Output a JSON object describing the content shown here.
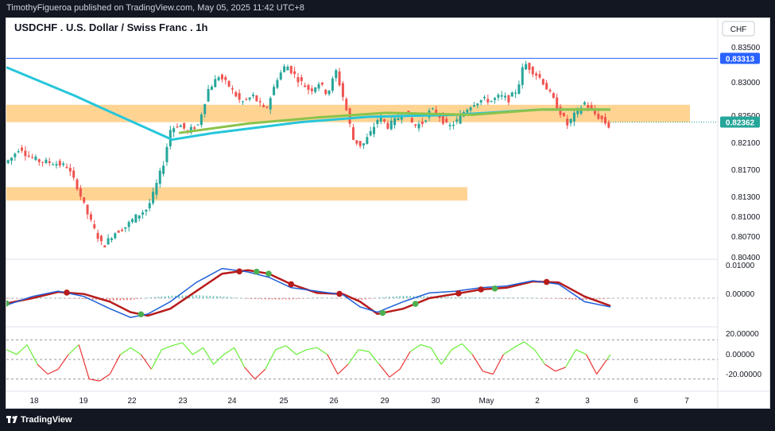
{
  "header": {
    "published_text": "TimothyFigueroa published on TradingView.com, May 05, 2025 11:42 UTC+8"
  },
  "chart": {
    "title": "USDCHF . U.S. Dollar / Swiss Franc . 1h",
    "currency_label": "CHF",
    "price_labels": [
      "0.83500",
      "0.83000",
      "0.82500",
      "0.82100",
      "0.81700",
      "0.81300",
      "0.81000",
      "0.80700",
      "0.80400"
    ],
    "resistance_badge": "0.83313",
    "last_price_badge": "0.82362",
    "macd_labels": [
      "0.01000",
      "0.00000"
    ],
    "osc_labels": [
      "20.00000",
      "0.00000",
      "-20.00000"
    ],
    "x_labels": [
      "18",
      "19",
      "22",
      "23",
      "24",
      "25",
      "26",
      "29",
      "30",
      "May",
      "2",
      "3",
      "6",
      "7"
    ]
  },
  "footer": {
    "brand": "TradingView"
  },
  "colors": {
    "up": "#26a69a",
    "down": "#ef5350",
    "ma_fast": "#26c6da",
    "ma_slow": "#8bc34a",
    "zone": "#ffcc80",
    "macd": "#1e5fd8",
    "signal": "#b71c1c",
    "osc_up": "#66ee33",
    "osc_down": "#ee3333"
  },
  "chart_data": {
    "type": "candlestick",
    "symbol": "USDCHF",
    "interval": "1h",
    "ylim": [
      0.8035,
      0.8365
    ],
    "x_ticks": [
      "18",
      "19",
      "22",
      "23",
      "24",
      "25",
      "26",
      "29",
      "30",
      "May",
      "2",
      "3",
      "6",
      "7"
    ],
    "horizontal_line": 0.83313,
    "last_price": 0.82362,
    "zones": [
      {
        "low": 0.8236,
        "high": 0.8262
      },
      {
        "low": 0.8119,
        "high": 0.8139
      }
    ],
    "price_path": [
      [
        0,
        0.8175
      ],
      [
        4,
        0.8183
      ],
      [
        9,
        0.82
      ],
      [
        13,
        0.8186
      ],
      [
        20,
        0.8178
      ],
      [
        29,
        0.8175
      ],
      [
        36,
        0.817
      ],
      [
        42,
        0.814
      ],
      [
        47,
        0.8105
      ],
      [
        52,
        0.8075
      ],
      [
        57,
        0.805
      ],
      [
        63,
        0.807
      ],
      [
        70,
        0.808
      ],
      [
        76,
        0.8095
      ],
      [
        82,
        0.8106
      ],
      [
        85,
        0.812
      ],
      [
        92,
        0.8175
      ],
      [
        96,
        0.8225
      ],
      [
        101,
        0.8233
      ],
      [
        106,
        0.8222
      ],
      [
        112,
        0.8232
      ],
      [
        118,
        0.8285
      ],
      [
        124,
        0.8305
      ],
      [
        130,
        0.829
      ],
      [
        137,
        0.8265
      ],
      [
        144,
        0.8275
      ],
      [
        151,
        0.8252
      ],
      [
        158,
        0.8302
      ],
      [
        163,
        0.8322
      ],
      [
        170,
        0.83
      ],
      [
        177,
        0.8283
      ],
      [
        182,
        0.8295
      ],
      [
        187,
        0.8278
      ],
      [
        192,
        0.8312
      ],
      [
        197,
        0.8265
      ],
      [
        202,
        0.821
      ],
      [
        207,
        0.82
      ],
      [
        212,
        0.822
      ],
      [
        217,
        0.8245
      ],
      [
        222,
        0.823
      ],
      [
        227,
        0.824
      ],
      [
        232,
        0.8255
      ],
      [
        237,
        0.823
      ],
      [
        242,
        0.8235
      ],
      [
        247,
        0.8255
      ],
      [
        252,
        0.8245
      ],
      [
        257,
        0.8228
      ],
      [
        262,
        0.8238
      ],
      [
        267,
        0.8255
      ],
      [
        272,
        0.8265
      ],
      [
        277,
        0.827
      ],
      [
        282,
        0.8268
      ],
      [
        287,
        0.8275
      ],
      [
        292,
        0.827
      ],
      [
        297,
        0.8285
      ],
      [
        301,
        0.8325
      ],
      [
        306,
        0.8312
      ],
      [
        311,
        0.83
      ],
      [
        316,
        0.8278
      ],
      [
        321,
        0.8255
      ],
      [
        326,
        0.8232
      ],
      [
        331,
        0.825
      ],
      [
        336,
        0.8265
      ],
      [
        341,
        0.825
      ],
      [
        346,
        0.824
      ],
      [
        350,
        0.823
      ]
    ],
    "ma_fast": [
      [
        0,
        0.8318
      ],
      [
        40,
        0.8275
      ],
      [
        70,
        0.824
      ],
      [
        96,
        0.821
      ],
      [
        120,
        0.822
      ],
      [
        170,
        0.8236
      ],
      [
        210,
        0.8244
      ],
      [
        260,
        0.8247
      ],
      [
        310,
        0.8255
      ],
      [
        350,
        0.8255
      ]
    ],
    "ma_slow": [
      [
        100,
        0.822
      ],
      [
        140,
        0.8234
      ],
      [
        180,
        0.8243
      ],
      [
        220,
        0.825
      ],
      [
        270,
        0.8247
      ],
      [
        310,
        0.8255
      ],
      [
        350,
        0.8255
      ]
    ],
    "macd": {
      "ylim": [
        -0.0075,
        0.01
      ],
      "macd_line": [
        [
          0,
          -0.002
        ],
        [
          15,
          0.0005
        ],
        [
          30,
          0.002
        ],
        [
          45,
          0.0005
        ],
        [
          60,
          -0.003
        ],
        [
          72,
          -0.0055
        ],
        [
          82,
          -0.0045
        ],
        [
          95,
          -0.001
        ],
        [
          110,
          0.0045
        ],
        [
          125,
          0.0085
        ],
        [
          140,
          0.0075
        ],
        [
          152,
          0.006
        ],
        [
          165,
          0.003
        ],
        [
          180,
          0.002
        ],
        [
          195,
          0.001
        ],
        [
          205,
          -0.0025
        ],
        [
          215,
          -0.004
        ],
        [
          230,
          -0.001
        ],
        [
          245,
          0.0015
        ],
        [
          260,
          0.002
        ],
        [
          275,
          0.003
        ],
        [
          290,
          0.0035
        ],
        [
          305,
          0.005
        ],
        [
          320,
          0.004
        ],
        [
          335,
          -0.001
        ],
        [
          350,
          -0.0025
        ]
      ],
      "signal_line": [
        [
          0,
          -0.0015
        ],
        [
          15,
          0.0
        ],
        [
          30,
          0.0018
        ],
        [
          45,
          0.0012
        ],
        [
          60,
          -0.001
        ],
        [
          72,
          -0.004
        ],
        [
          82,
          -0.005
        ],
        [
          95,
          -0.003
        ],
        [
          110,
          0.002
        ],
        [
          125,
          0.007
        ],
        [
          140,
          0.008
        ],
        [
          152,
          0.007
        ],
        [
          165,
          0.004
        ],
        [
          180,
          0.0015
        ],
        [
          195,
          0.0012
        ],
        [
          205,
          -0.001
        ],
        [
          215,
          -0.0045
        ],
        [
          230,
          -0.003
        ],
        [
          245,
          0.0
        ],
        [
          260,
          0.0012
        ],
        [
          275,
          0.0025
        ],
        [
          290,
          0.003
        ],
        [
          305,
          0.0048
        ],
        [
          320,
          0.0045
        ],
        [
          335,
          0.0005
        ],
        [
          350,
          -0.0022
        ]
      ],
      "cross_down": [
        35,
        135,
        165,
        193,
        262,
        275,
        313
      ],
      "cross_up": [
        0,
        78,
        145,
        152,
        218,
        237,
        283
      ]
    },
    "oscillator": {
      "ylim": [
        -30,
        30
      ],
      "levels": [
        20,
        0,
        -20
      ],
      "values": [
        [
          0,
          10
        ],
        [
          6,
          5
        ],
        [
          12,
          15
        ],
        [
          18,
          -5
        ],
        [
          24,
          -15
        ],
        [
          30,
          -10
        ],
        [
          36,
          5
        ],
        [
          42,
          15
        ],
        [
          48,
          -20
        ],
        [
          54,
          -22
        ],
        [
          60,
          -15
        ],
        [
          66,
          5
        ],
        [
          72,
          12
        ],
        [
          78,
          5
        ],
        [
          84,
          -10
        ],
        [
          90,
          10
        ],
        [
          96,
          14
        ],
        [
          102,
          17
        ],
        [
          108,
          5
        ],
        [
          114,
          12
        ],
        [
          120,
          -5
        ],
        [
          126,
          5
        ],
        [
          132,
          12
        ],
        [
          138,
          -8
        ],
        [
          144,
          -20
        ],
        [
          150,
          -10
        ],
        [
          156,
          10
        ],
        [
          162,
          14
        ],
        [
          168,
          5
        ],
        [
          174,
          10
        ],
        [
          180,
          12
        ],
        [
          186,
          5
        ],
        [
          192,
          -15
        ],
        [
          198,
          -5
        ],
        [
          204,
          10
        ],
        [
          210,
          8
        ],
        [
          216,
          -5
        ],
        [
          222,
          -18
        ],
        [
          228,
          -10
        ],
        [
          234,
          8
        ],
        [
          240,
          15
        ],
        [
          246,
          12
        ],
        [
          252,
          -5
        ],
        [
          258,
          10
        ],
        [
          264,
          16
        ],
        [
          270,
          5
        ],
        [
          276,
          -12
        ],
        [
          282,
          -15
        ],
        [
          288,
          5
        ],
        [
          294,
          12
        ],
        [
          300,
          18
        ],
        [
          306,
          10
        ],
        [
          312,
          -5
        ],
        [
          318,
          -12
        ],
        [
          324,
          -8
        ],
        [
          330,
          10
        ],
        [
          336,
          5
        ],
        [
          342,
          -15
        ],
        [
          348,
          0
        ],
        [
          350,
          5
        ]
      ]
    }
  }
}
